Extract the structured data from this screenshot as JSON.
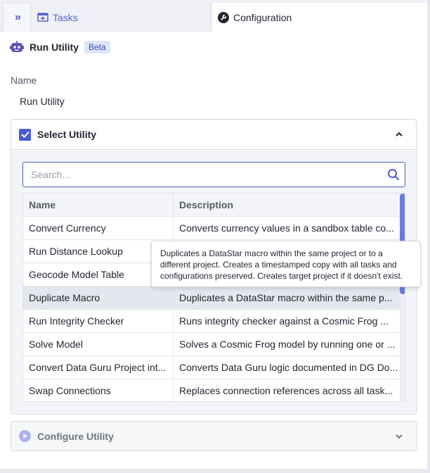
{
  "tabs": {
    "toggle_icon": "double-chevron-right-icon",
    "tasks_label": "Tasks",
    "configuration_label": "Configuration"
  },
  "header": {
    "title": "Run Utility",
    "badge": "Beta"
  },
  "name_field": {
    "label": "Name",
    "value": "Run Utility"
  },
  "select_utility": {
    "title": "Select Utility",
    "search_placeholder": "Search...",
    "columns": [
      "Name",
      "Description"
    ],
    "rows": [
      {
        "name": "Convert Currency",
        "description": "Converts currency values in a sandbox table co..."
      },
      {
        "name": "Run Distance Lookup",
        "description": ""
      },
      {
        "name": "Geocode Model Table",
        "description": ""
      },
      {
        "name": "Duplicate Macro",
        "description": "Duplicates a DataStar macro within the same p..."
      },
      {
        "name": "Run Integrity Checker",
        "description": "Runs integrity checker against a Cosmic Frog ..."
      },
      {
        "name": "Solve Model",
        "description": "Solves a Cosmic Frog model by running one or ..."
      },
      {
        "name": "Convert Data Guru Project int...",
        "description": "Converts Data Guru logic documented in DG Do..."
      },
      {
        "name": "Swap Connections",
        "description": "Replaces connection references across all task..."
      }
    ],
    "selected_row": 3,
    "tooltip": "Duplicates a DataStar macro within the same project or to a different project. Creates a timestamped copy with all tasks and configurations preserved. Creates target project if it doesn't exist."
  },
  "configure_utility": {
    "title": "Configure Utility"
  },
  "colors": {
    "accent": "#4b5bd0",
    "badge_bg": "#dde6fb",
    "selected_row": "#e4e7ee"
  }
}
